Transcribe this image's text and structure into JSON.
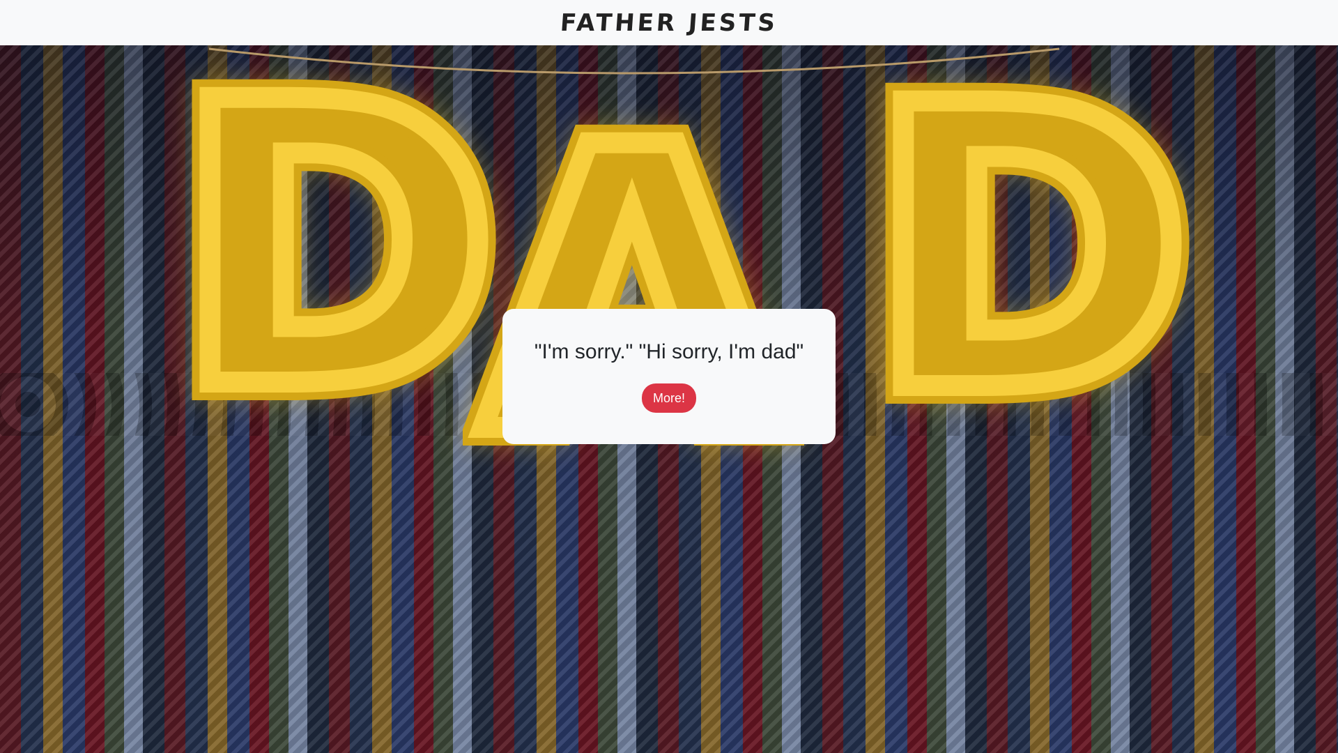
{
  "navbar": {
    "brand": "FATHER JESTS"
  },
  "hero": {
    "balloon_letters": [
      "D",
      "A",
      "D"
    ],
    "balloon_color": "#d4a616"
  },
  "joke_card": {
    "joke_text": "\"I'm sorry.\" \"Hi sorry, I'm dad\"",
    "more_button_label": "More!",
    "button_color": "#dc3545"
  }
}
